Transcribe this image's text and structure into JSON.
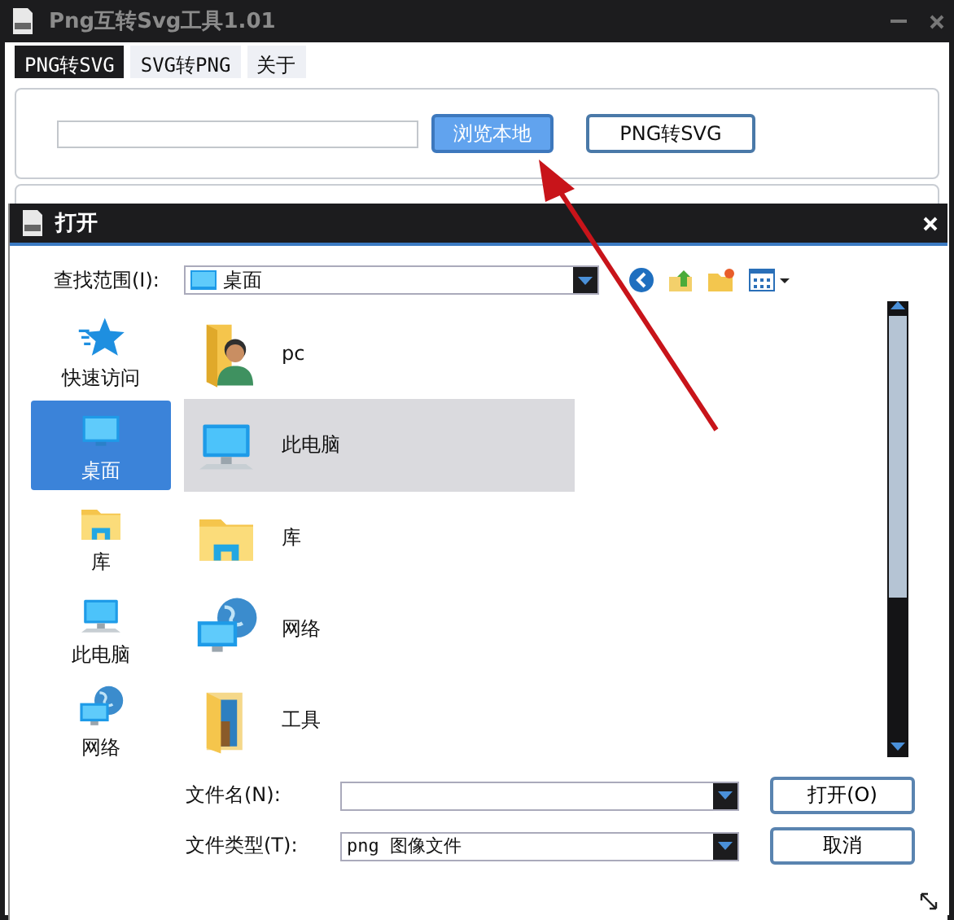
{
  "window": {
    "title": "Png互转Svg工具1.01"
  },
  "tabs": [
    {
      "label": "PNG转SVG",
      "selected": true
    },
    {
      "label": "SVG转PNG",
      "selected": false
    },
    {
      "label": "关于",
      "selected": false
    }
  ],
  "converter": {
    "buttons": [
      {
        "label": "浏览本地",
        "highlighted": true
      },
      {
        "label": "PNG转SVG",
        "highlighted": false
      }
    ]
  },
  "dialog": {
    "title": "打开",
    "look_in_label": "查找范围(I):",
    "look_in_value": "桌面",
    "places": [
      {
        "label": "快速访问",
        "kind": "quick-access",
        "selected": false
      },
      {
        "label": "桌面",
        "kind": "desktop",
        "selected": true
      },
      {
        "label": "库",
        "kind": "library",
        "selected": false
      },
      {
        "label": "此电脑",
        "kind": "computer",
        "selected": false
      },
      {
        "label": "网络",
        "kind": "network",
        "selected": false
      }
    ],
    "files": [
      {
        "name": "pc",
        "kind": "user-folder",
        "selected": false
      },
      {
        "name": "此电脑",
        "kind": "computer",
        "selected": true
      },
      {
        "name": "库",
        "kind": "library",
        "selected": false
      },
      {
        "name": "网络",
        "kind": "network",
        "selected": false
      },
      {
        "name": "工具",
        "kind": "folder",
        "selected": false
      }
    ],
    "file_name_label": "文件名(N):",
    "file_type_label": "文件类型(T):",
    "file_type_value": "png 图像文件",
    "buttons": [
      "打开(O)",
      "取消"
    ]
  }
}
